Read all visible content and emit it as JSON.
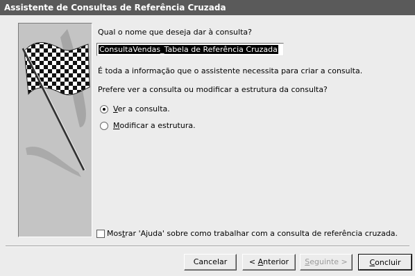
{
  "window": {
    "title": "Assistente de Consultas de Referência Cruzada"
  },
  "wizard": {
    "name_question": "Qual o nome que deseja dar à consulta?",
    "query_name_value": "ConsultaVendas_Tabela de Referência Cruzada",
    "info_text": "É toda a informação que o assistente necessita para criar a consulta.",
    "choice_question": "Prefere ver a consulta ou modificar a estrutura da consulta?",
    "options": [
      {
        "hotkey": "V",
        "rest": "er a consulta.",
        "selected": true
      },
      {
        "hotkey": "M",
        "rest": "odificar a estrutura.",
        "selected": false
      }
    ],
    "help_checkbox": {
      "before": "Mos",
      "hotkey": "t",
      "after": "rar 'Ajuda' sobre como trabalhar com a consulta de referência cruzada.",
      "checked": false
    }
  },
  "buttons": {
    "cancel": "Cancelar",
    "back_prefix": "< ",
    "back_hotkey": "A",
    "back_rest": "nterior",
    "next_hotkey": "S",
    "next_rest": "eguinte >",
    "finish_hotkey": "C",
    "finish_rest": "oncluir"
  },
  "icons": [
    "checkered-flag-illustration",
    "radio-selected-icon",
    "radio-unselected-icon",
    "checkbox-icon"
  ],
  "colors": {
    "title_bar": "#5a5a5a",
    "dialog_background": "#ececec",
    "image_panel": "#c4c4c4",
    "selection": "#000000"
  }
}
